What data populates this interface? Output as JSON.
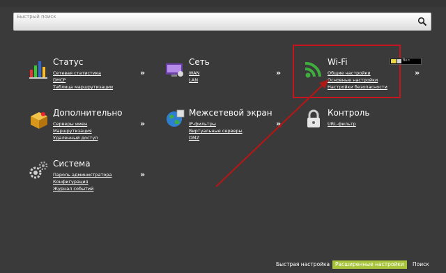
{
  "search": {
    "placeholder": "Быстрый поиск"
  },
  "sections": {
    "status": {
      "title": "Статус",
      "icon": "bar-chart-icon",
      "links": [
        "Сетевая статистика",
        "DHCP",
        "Таблица маршрутизации"
      ]
    },
    "network": {
      "title": "Сеть",
      "icon": "monitor-icon",
      "links": [
        "WAN",
        "LAN"
      ]
    },
    "wifi": {
      "title": "Wi-Fi",
      "icon": "wifi-icon",
      "links": [
        "Общие настройки",
        "Основные настройки",
        "Настройки безопасности"
      ]
    },
    "advanced": {
      "title": "Дополнительно",
      "icon": "box-icon",
      "links": [
        "Серверы имен",
        "Маршрутизация",
        "Удаленный доступ"
      ]
    },
    "firewall": {
      "title": "Межсетевой экран",
      "icon": "globe-icon",
      "links": [
        "IP-фильтры",
        "Виртуальные серверы",
        "DMZ"
      ]
    },
    "control": {
      "title": "Контроль",
      "icon": "lock-icon",
      "links": [
        "URL-фильтр"
      ]
    },
    "system": {
      "title": "Система",
      "icon": "gears-icon",
      "links": [
        "Пароль администратора",
        "Конфигурация",
        "Журнал событий"
      ]
    }
  },
  "arrow_symbol": "»",
  "footer": {
    "quick_setup": "Быстрая настройка",
    "advanced_settings": "Расширенные настройки",
    "search": "Поиск"
  },
  "colors": {
    "background": "#3a3a3a",
    "highlight": "#c8141c",
    "active_footer": "#a8c43a"
  }
}
